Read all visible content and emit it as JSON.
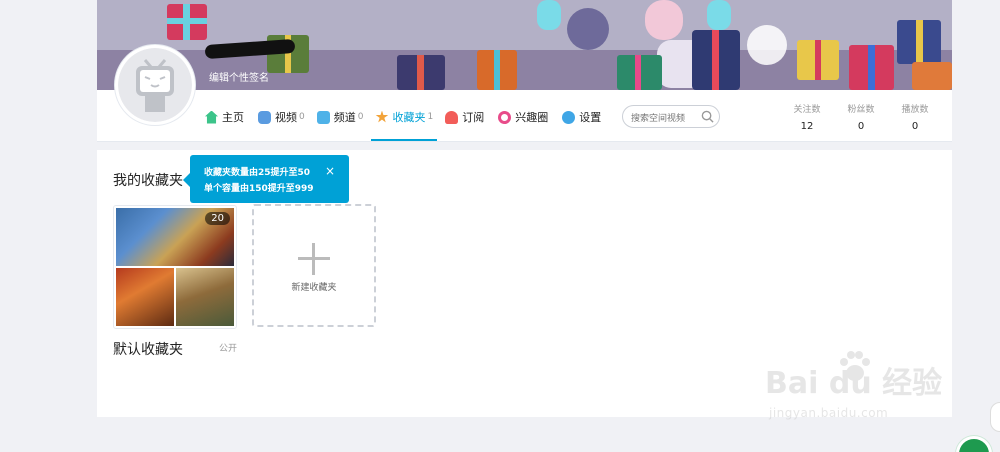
{
  "profile": {
    "sign": "编辑个性签名"
  },
  "nav": [
    {
      "label": "主页",
      "count": "",
      "icon": "home-icon",
      "color": "#3cc48a"
    },
    {
      "label": "视频",
      "count": "0",
      "icon": "video-icon",
      "color": "#5a9be0"
    },
    {
      "label": "频道",
      "count": "0",
      "icon": "channel-icon",
      "color": "#4fb2e8"
    },
    {
      "label": "收藏夹",
      "count": "1",
      "icon": "star-icon",
      "color": "#f2a33a"
    },
    {
      "label": "订阅",
      "count": "",
      "icon": "heart-icon",
      "color": "#f25d59"
    },
    {
      "label": "兴趣圈",
      "count": "",
      "icon": "circle-icon",
      "color": "#e84c8a"
    },
    {
      "label": "设置",
      "count": "",
      "icon": "gear-icon",
      "color": "#3fa6e6"
    }
  ],
  "search": {
    "placeholder": "搜索空间视频"
  },
  "stats": [
    {
      "label": "关注数",
      "value": "12"
    },
    {
      "label": "粉丝数",
      "value": "0"
    },
    {
      "label": "播放数",
      "value": "0"
    }
  ],
  "favorites": {
    "title": "我的收藏夹",
    "tooltip": {
      "line1": "收藏夹数量由25提升至50",
      "line2": "单个容量由150提升至999",
      "close": "×"
    },
    "items": [
      {
        "name": "默认收藏夹",
        "state": "公开",
        "count": "20"
      }
    ],
    "new_label": "新建收藏夹"
  },
  "watermark": {
    "brand": "Bai du 经验",
    "url": "jingyan.baidu.com"
  },
  "colors": {
    "accent": "#00a1d6",
    "background": "#f0f1f5"
  }
}
